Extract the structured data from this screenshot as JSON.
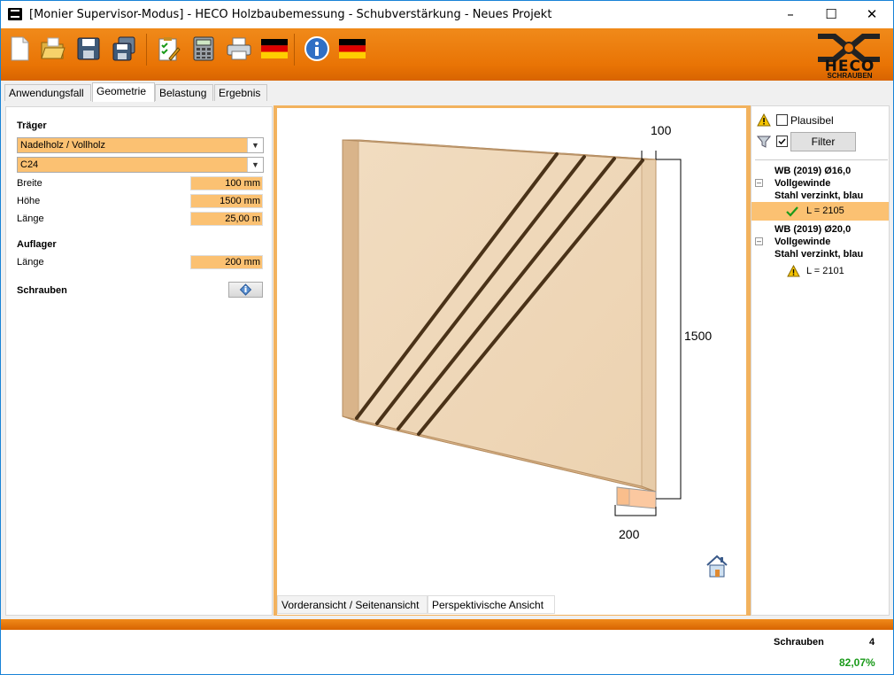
{
  "window": {
    "title": "[Monier Supervisor-Modus] - HECO Holzbaubemessung - Schubverstärkung - Neues Projekt",
    "controls": [
      "–",
      "☐",
      "✕"
    ]
  },
  "toolbar": {
    "icons": [
      "new-file-icon",
      "open-folder-icon",
      "save-icon",
      "save-as-icon",
      "checklist-icon",
      "calculator-icon",
      "print-icon",
      "german-flag-icon",
      "info-icon",
      "german-flag-icon"
    ]
  },
  "logo": {
    "text": "HECO",
    "sub": "SCHRAUBEN"
  },
  "tabs": [
    "Anwendungsfall",
    "Geometrie",
    "Belastung",
    "Ergebnis"
  ],
  "active_tab": "Geometrie",
  "traeger": {
    "heading": "Träger",
    "material": "Nadelholz / Vollholz",
    "grade": "C24",
    "breite_label": "Breite",
    "breite_value": "100 mm",
    "hoehe_label": "Höhe",
    "hoehe_value": "1500 mm",
    "laenge_label": "Länge",
    "laenge_value": "25,00 m"
  },
  "auflager": {
    "heading": "Auflager",
    "laenge_label": "Länge",
    "laenge_value": "200 mm"
  },
  "schrauben": {
    "heading": "Schrauben"
  },
  "view": {
    "dim_width": "100",
    "dim_height": "1500",
    "dim_support": "200",
    "tabs": [
      "Vorderansicht / Seitenansicht",
      "Perspektivische Ansicht"
    ]
  },
  "right": {
    "plausibel_label": "Plausibel",
    "filter_label": "Filter",
    "groups": [
      {
        "line1": "WB (2019) Ø16,0",
        "line2": "Vollgewinde",
        "line3": "Stahl verzinkt, blau",
        "leaf": "L = 2105",
        "status": "ok"
      },
      {
        "line1": "WB (2019) Ø20,0",
        "line2": "Vollgewinde",
        "line3": "Stahl verzinkt, blau",
        "leaf": "L = 2101",
        "status": "warning"
      }
    ]
  },
  "status": {
    "label": "Schrauben",
    "count": "4",
    "percent": "82,07%"
  },
  "colors": {
    "accent": "#e97405",
    "field": "#fbc172",
    "ok_green": "#1a9a1a"
  }
}
